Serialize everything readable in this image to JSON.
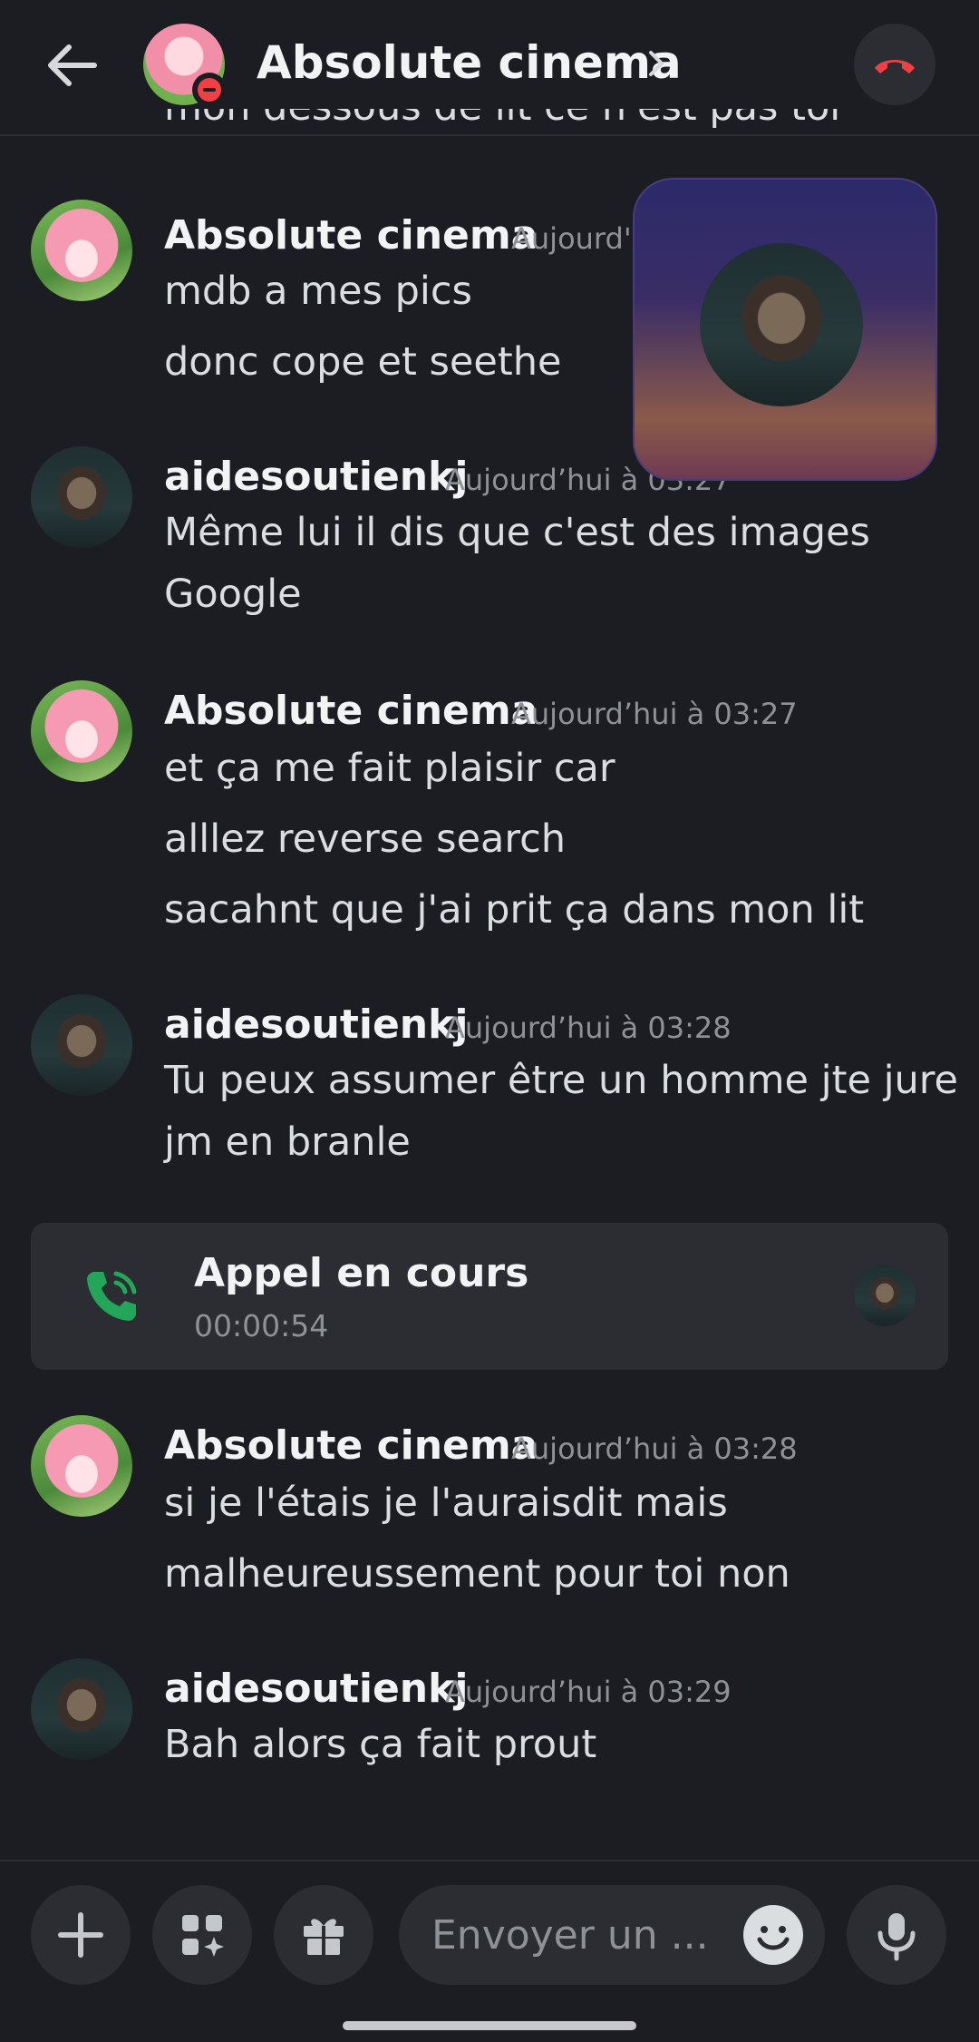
{
  "header": {
    "title": "Absolute cinema"
  },
  "top_partial_text": "mon dessous de lit ce n'est pas toi",
  "messages": [
    {
      "author": "Absolute cinema",
      "timestamp": "Aujourd'hui à 03:27",
      "lines": [
        "mdb a mes pics",
        "donc cope et seethe"
      ]
    },
    {
      "author": "aidesoutienkj",
      "timestamp": "Aujourd’hui à 03:27",
      "lines": [
        "Même lui il dis que c'est des images",
        "Google"
      ]
    },
    {
      "author": "Absolute cinema",
      "timestamp": "Aujourd’hui à 03:27",
      "lines": [
        "et ça me fait plaisir car",
        "alllez reverse search",
        "sacahnt que j'ai prit ça dans mon lit"
      ]
    },
    {
      "author": "aidesoutienkj",
      "timestamp": "Aujourd’hui à 03:28",
      "lines": [
        "Tu peux assumer être un homme jte jure",
        "jm en branle"
      ]
    },
    {
      "author": "Absolute cinema",
      "timestamp": "Aujourd’hui à 03:28",
      "lines": [
        "si je l'étais je l'auraisdit mais",
        "malheureussement pour toi non"
      ]
    },
    {
      "author": "aidesoutienkj",
      "timestamp": "Aujourd’hui à 03:29",
      "lines": [
        "Bah alors ça fait prout"
      ]
    }
  ],
  "call": {
    "title": "Appel en cours",
    "duration": "00:00:54"
  },
  "composer": {
    "placeholder": "Envoyer un ..."
  },
  "colors": {
    "background": "#1c1d22",
    "surface": "#2b2d33",
    "call_green": "#23a55a",
    "hangup_red": "#f23f43"
  }
}
